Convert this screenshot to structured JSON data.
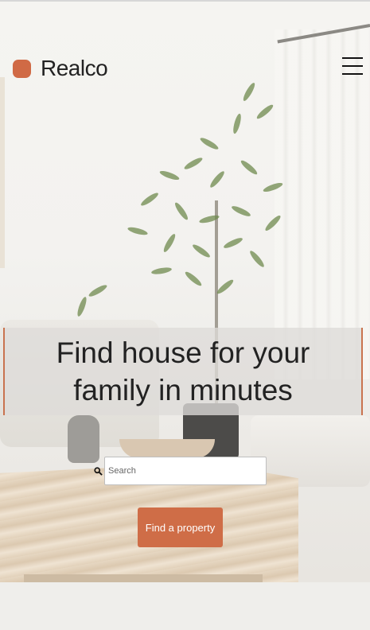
{
  "brand": {
    "name": "Realco",
    "accent_color": "#d06a45"
  },
  "header": {
    "menu_icon": "hamburger-icon"
  },
  "hero": {
    "title": "Find house for your family in minutes"
  },
  "search": {
    "icon": "search-icon",
    "placeholder": "Search",
    "value": ""
  },
  "cta": {
    "label": "Find a property"
  }
}
